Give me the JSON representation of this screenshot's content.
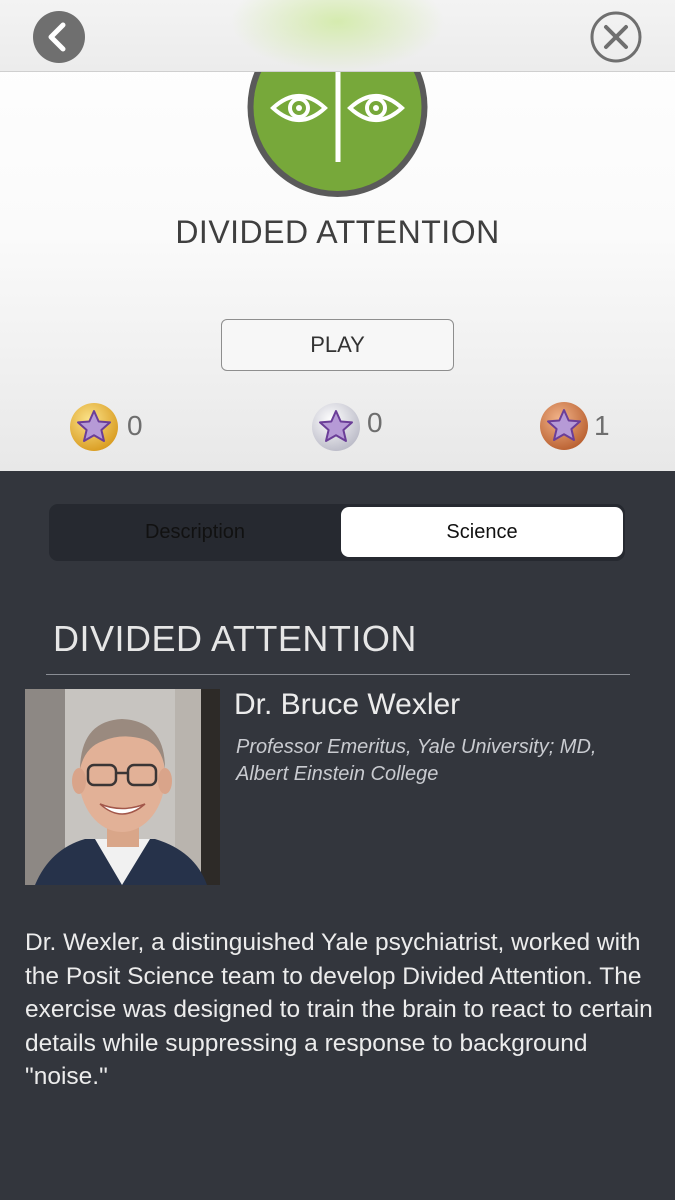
{
  "header": {
    "back_icon": "chevron-left-icon",
    "close_icon": "close-circle-icon"
  },
  "game": {
    "title": "DIVIDED ATTENTION",
    "icon": "eyes-icon",
    "icon_color": "#77a83a",
    "play_label": "PLAY"
  },
  "medals": [
    {
      "kind": "gold",
      "count": "0",
      "color": "#e0ac2b"
    },
    {
      "kind": "silver",
      "count": "0",
      "color": "#cfcfd8"
    },
    {
      "kind": "bronze",
      "count": "1",
      "color": "#c9703c"
    }
  ],
  "tabs": [
    {
      "label": "Description",
      "selected": false
    },
    {
      "label": "Science",
      "selected": true
    }
  ],
  "science": {
    "section_title": "DIVIDED ATTENTION",
    "scientist_name": "Dr. Bruce Wexler",
    "affiliation": "Professor Emeritus, Yale University; MD, Albert Einstein College",
    "bio": "Dr. Wexler, a distinguished Yale psychiatrist, worked with the Posit Science team to develop Divided Attention. The exercise was designed to train the brain to react to certain details while suppressing a response to background \"noise.\""
  }
}
